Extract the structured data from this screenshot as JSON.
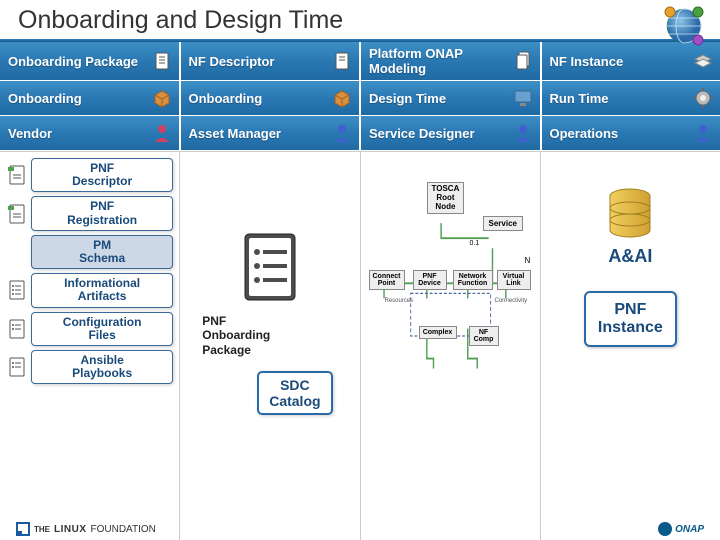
{
  "title": "Onboarding and Design Time",
  "table": {
    "rows": [
      [
        "Onboarding Package",
        "NF Descriptor",
        "Platform ONAP Modeling",
        "NF Instance"
      ],
      [
        "Onboarding",
        "Onboarding",
        "Design Time",
        "Run Time"
      ],
      [
        "Vendor",
        "Asset Manager",
        "Service Designer",
        "Operations"
      ]
    ],
    "row_icons": [
      [
        "document-icon",
        "document-icon",
        "document-stack-icon",
        "layer-icon"
      ],
      [
        "box-icon",
        "box-icon",
        "monitor-icon",
        "gear-icon"
      ],
      [
        "person-icon",
        "person-icon",
        "person-icon",
        "person-icon"
      ]
    ]
  },
  "col1": {
    "items": [
      {
        "label": "PNF\nDescriptor",
        "icon": "tagged-doc-icon"
      },
      {
        "label": "PNF\nRegistration",
        "icon": "tagged-doc-icon"
      },
      {
        "label": "PM\nSchema",
        "icon": "",
        "pm": true
      },
      {
        "label": "Informational\nArtifacts",
        "icon": "list-doc-icon"
      },
      {
        "label": "Configuration\nFiles",
        "icon": "list-doc-icon"
      },
      {
        "label": "Ansible\nPlaybooks",
        "icon": "list-doc-icon"
      }
    ]
  },
  "col2": {
    "package_label": "PNF\nOnboarding\nPackage",
    "sdc": "SDC\nCatalog"
  },
  "col3": {
    "tosca": "TOSCA\nRoot\nNode",
    "service": "Service",
    "nodes": {
      "cp": "Connect\nPoint",
      "pnf": "PNF\nDevice",
      "nf": "Network\nFunction",
      "vl": "Virtual\nLink",
      "complex": "Complex",
      "nfcomp": "NF\nComp"
    },
    "labels": {
      "n": "N",
      "ratio": "0.1",
      "resources": "Resources",
      "connectivity": "Connectivity"
    }
  },
  "col4": {
    "db": "A&AI",
    "instance": "PNF\nInstance"
  },
  "footer": {
    "left1": "THE",
    "left2": "LINUX",
    "left3": "FOUNDATION",
    "right": "ONAP"
  }
}
